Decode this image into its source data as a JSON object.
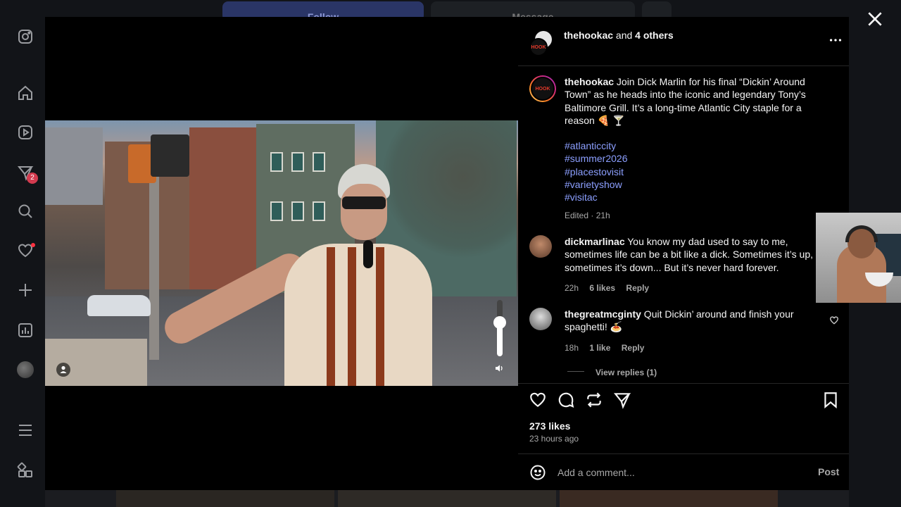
{
  "background": {
    "follow_label": "Follow",
    "message_label": "Message"
  },
  "sidebar": {
    "items": [
      {
        "name": "instagram-logo",
        "icon": "instagram-icon"
      },
      {
        "name": "home",
        "icon": "home-icon"
      },
      {
        "name": "reels",
        "icon": "reels-icon"
      },
      {
        "name": "messages",
        "icon": "direct-icon"
      },
      {
        "name": "search",
        "icon": "search-icon"
      },
      {
        "name": "notifications",
        "icon": "heart-icon"
      },
      {
        "name": "create",
        "icon": "plus-icon"
      },
      {
        "name": "dashboard",
        "icon": "chart-icon"
      },
      {
        "name": "profile",
        "icon": "avatar"
      },
      {
        "name": "more",
        "icon": "menu-icon"
      },
      {
        "name": "also-from-meta",
        "icon": "apps-icon"
      }
    ],
    "messages_badge": "2"
  },
  "post": {
    "header": {
      "author": "thehookac",
      "and_text": " and ",
      "others": "4 others",
      "logo_text": "HOOK"
    },
    "caption": {
      "username": "thehookac",
      "text": " Join Dick Marlin for his final “Dickin’ Around Town” as he heads into the iconic and legendary Tony’s Baltimore Grill. It’s a long-time Atlantic City staple for a reason 🍕 🍸",
      "hashtags": [
        "#atlanticcity",
        "#summer2026",
        "#placestovisit",
        "#varietyshow",
        "#visitac"
      ],
      "meta": "Edited · 21h"
    },
    "comments": [
      {
        "username": "dickmarlinac",
        "text": " You know my dad used to say to me, sometimes life can be a bit like a dick. Sometimes it’s up, sometimes it’s down... But it’s never hard forever.",
        "time": "22h",
        "likes": "6 likes",
        "reply": "Reply"
      },
      {
        "username": "thegreatmcginty",
        "text": " Quit Dickin’ around and finish your spaghetti! 🍝",
        "time": "18h",
        "likes": "1 like",
        "reply": "Reply",
        "view_replies": "View replies (1)"
      }
    ],
    "likes": "273 likes",
    "time_ago": "23 hours ago",
    "comment_placeholder": "Add a comment...",
    "post_label": "Post"
  },
  "colors": {
    "hashtag": "#8c9fff",
    "muted": "#a8a8a8",
    "badge": "#d33b4f"
  }
}
